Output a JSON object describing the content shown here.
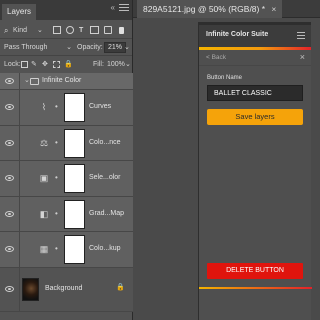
{
  "document": {
    "tab_title": "829A5121.jpg @ 50% (RGB/8) *",
    "close_glyph": "×"
  },
  "layers_panel": {
    "tab_label": "Layers",
    "collapse_glyph": "«",
    "filter": {
      "label": "Kind"
    },
    "blend_mode": "Pass Through",
    "opacity_label": "Opacity:",
    "opacity_value": "21%",
    "lock_label": "Lock:",
    "fill_label": "Fill:",
    "fill_value": "100%",
    "group": {
      "name": "Infinite Color"
    },
    "layers": [
      {
        "name": "Curves",
        "icon": "curves-icon",
        "glyph": "⌇"
      },
      {
        "name": "Colo...nce",
        "icon": "color-balance-icon",
        "glyph": "⚖"
      },
      {
        "name": "Sele...olor",
        "icon": "selective-color-icon",
        "glyph": "▣"
      },
      {
        "name": "Grad...Map",
        "icon": "gradient-map-icon",
        "glyph": "◧"
      },
      {
        "name": "Colo...kup",
        "icon": "color-lookup-icon",
        "glyph": "▦"
      }
    ],
    "background": {
      "name": "Background",
      "lock_glyph": "🔒"
    }
  },
  "plugin": {
    "title": "Infinite Color Suite",
    "back_label": "< Back",
    "close_glyph": "×",
    "button_name_label": "Button Name",
    "button_name_value": "BALLET CLASSIC",
    "save_label": "Save layers",
    "delete_label": "DELETE BUTTON",
    "colors": {
      "save": "#f5a30a",
      "delete": "#e0140d",
      "accent_start": "#f5b400",
      "accent_end": "#e3222a"
    }
  }
}
